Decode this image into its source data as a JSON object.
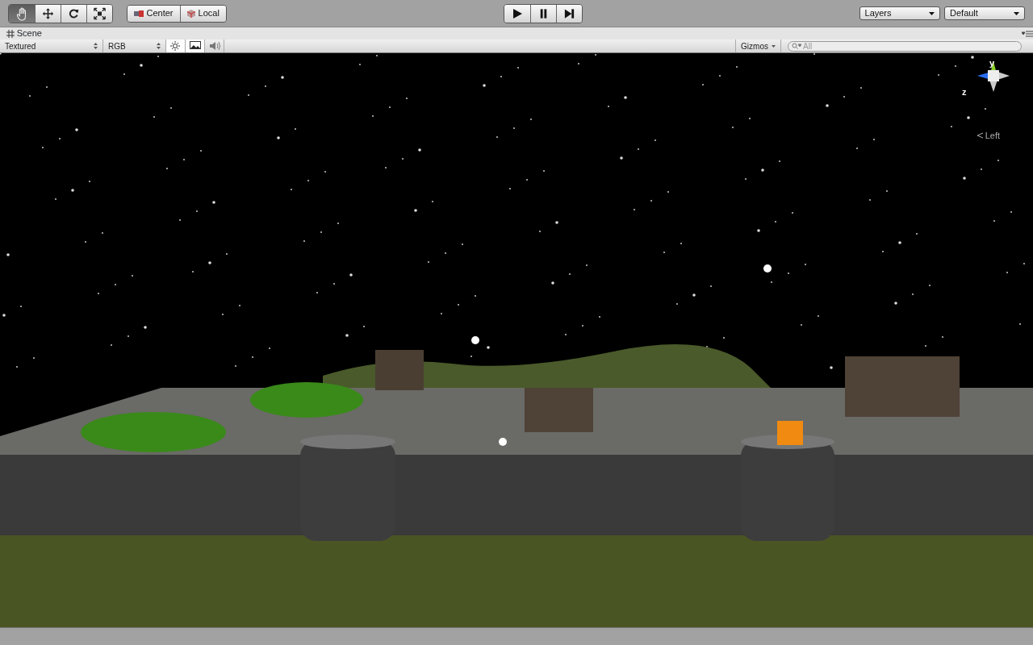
{
  "toolbar": {
    "tools": [
      {
        "kind": "hand",
        "selected": true
      },
      {
        "kind": "move",
        "selected": false
      },
      {
        "kind": "rotate",
        "selected": false
      },
      {
        "kind": "scale",
        "selected": false
      }
    ],
    "pivot": [
      {
        "kind": "pivot",
        "label": "Center"
      },
      {
        "kind": "space",
        "label": "Local"
      }
    ],
    "playback": [
      {
        "kind": "play"
      },
      {
        "kind": "pause"
      },
      {
        "kind": "step"
      }
    ],
    "dropdowns": [
      {
        "label": "Layers"
      },
      {
        "label": "Default"
      }
    ]
  },
  "scene_tab": {
    "label": "Scene"
  },
  "scene_toolbar": {
    "render_mode": "Textured",
    "channel": "RGB",
    "toggles": [
      {
        "kind": "lighting",
        "on": true
      },
      {
        "kind": "effects",
        "on": true
      },
      {
        "kind": "audio",
        "on": false
      }
    ],
    "gizmos": "Gizmos",
    "search": {
      "placeholder": "All"
    }
  },
  "viewport": {
    "axis_labels": [
      "y",
      "z"
    ],
    "view_label": "Left"
  }
}
